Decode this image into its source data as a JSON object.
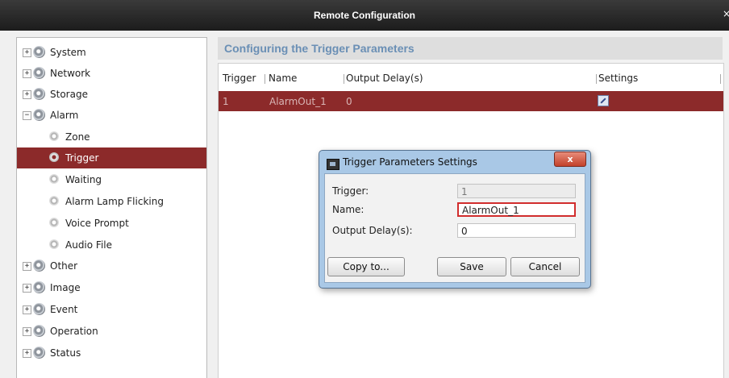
{
  "window": {
    "title": "Remote Configuration"
  },
  "tree": {
    "items": [
      {
        "label": "System",
        "toggle": "+"
      },
      {
        "label": "Network",
        "toggle": "+"
      },
      {
        "label": "Storage",
        "toggle": "+"
      },
      {
        "label": "Alarm",
        "toggle": "−"
      },
      {
        "label": "Zone"
      },
      {
        "label": "Trigger"
      },
      {
        "label": "Waiting"
      },
      {
        "label": "Alarm Lamp Flicking"
      },
      {
        "label": "Voice Prompt"
      },
      {
        "label": "Audio File"
      },
      {
        "label": "Other",
        "toggle": "+"
      },
      {
        "label": "Image",
        "toggle": "+"
      },
      {
        "label": "Event",
        "toggle": "+"
      },
      {
        "label": "Operation",
        "toggle": "+"
      },
      {
        "label": "Status",
        "toggle": "+"
      }
    ]
  },
  "panel": {
    "heading": "Configuring the Trigger Parameters",
    "columns": [
      "Trigger",
      "Name",
      "Output Delay(s)",
      "Settings"
    ],
    "rows": [
      {
        "trigger": "1",
        "name": "AlarmOut_1",
        "delay": "0",
        "settings_icon": "edit-icon"
      }
    ]
  },
  "dialog": {
    "title": "Trigger Parameters Settings",
    "close_label": "x",
    "fields": {
      "trigger": {
        "label": "Trigger:",
        "value": "1"
      },
      "name": {
        "label": "Name:",
        "value": "AlarmOut_1"
      },
      "delay": {
        "label": "Output Delay(s):",
        "value": "0"
      }
    },
    "buttons": {
      "copy": "Copy to...",
      "save": "Save",
      "cancel": "Cancel"
    }
  },
  "colors": {
    "selection": "#8c2a2a",
    "heading": "#6a8fb5",
    "dialog_frame": "#a9c8e6"
  }
}
